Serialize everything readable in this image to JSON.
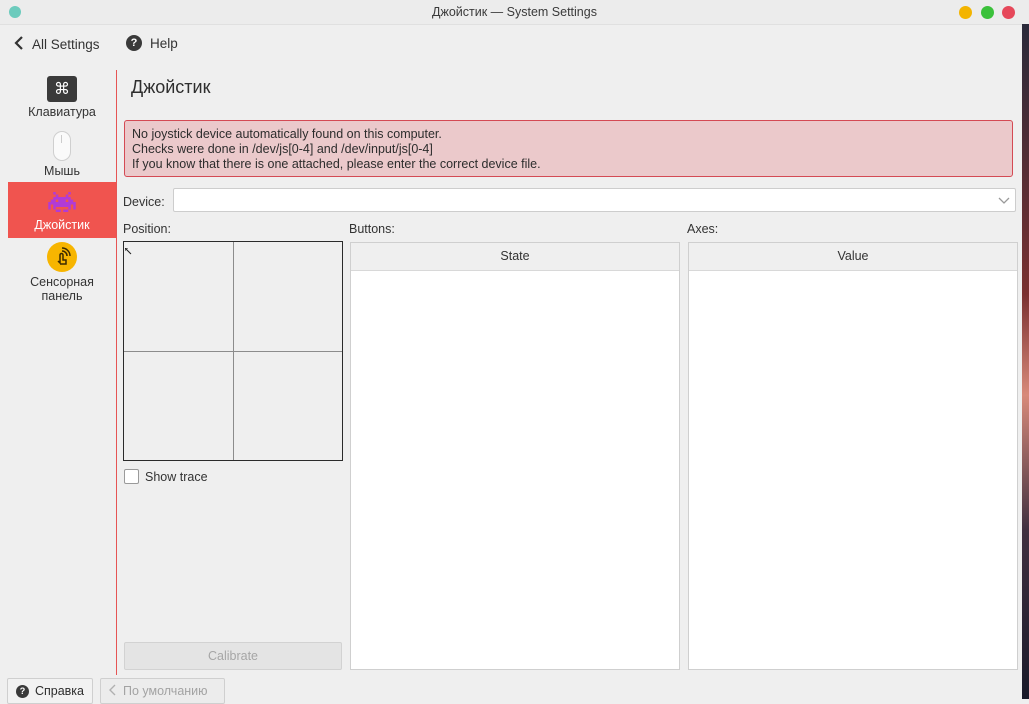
{
  "window": {
    "title": "Джойстик — System Settings"
  },
  "toolbar": {
    "back_label": "All Settings",
    "help_label": "Help"
  },
  "sidebar": {
    "items": [
      {
        "label": "Клавиатура",
        "icon": "keyboard-icon",
        "active": false
      },
      {
        "label": "Мышь",
        "icon": "mouse-icon",
        "active": false
      },
      {
        "label": "Джойстик",
        "icon": "joystick-invader-icon",
        "active": true
      },
      {
        "label_line1": "Сенсорная",
        "label_line2": "панель",
        "icon": "touchpad-icon",
        "active": false
      }
    ]
  },
  "page": {
    "title": "Джойстик",
    "alert": {
      "line1": "No joystick device automatically found on this computer.",
      "line2": "Checks were done in /dev/js[0-4] and /dev/input/js[0-4]",
      "line3": "If you know that there is one attached, please enter the correct device file."
    },
    "device_label": "Device:",
    "device_value": "",
    "position_label": "Position:",
    "buttons_label": "Buttons:",
    "axes_label": "Axes:",
    "show_trace_label": "Show trace",
    "show_trace_checked": false,
    "calibrate_label": "Calibrate",
    "buttons_table": {
      "header": "State",
      "rows": []
    },
    "axes_table": {
      "header": "Value",
      "rows": []
    }
  },
  "footer": {
    "help_label": "Справка",
    "defaults_label": "По умолчанию"
  },
  "colors": {
    "accent": "#f0544f",
    "alert_bg": "#ebc9cb",
    "alert_border": "#d44a54",
    "touchpad_icon": "#f7b500",
    "joystick_icon": "#b13bd6"
  }
}
